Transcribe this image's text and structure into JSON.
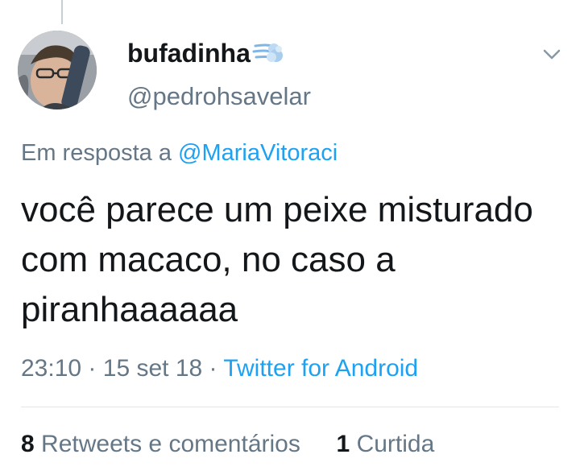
{
  "tweet": {
    "display_name": "bufadinha",
    "name_emoji": "dash-emoji",
    "handle": "@pedrohsavelar",
    "reply_prefix": "Em resposta a",
    "reply_mention": "@MariaVitoraci",
    "text": "você parece um peixe misturado com macaco, no caso a piranhaaaaaa",
    "time": "23:10",
    "date": "15 set 18",
    "separator": "·",
    "source": "Twitter for Android",
    "retweets_count": "8",
    "retweets_label": "Retweets e comentários",
    "likes_count": "1",
    "likes_label": "Curtida"
  },
  "icons": {
    "caret": "chevron-down-icon",
    "avatar": "avatar"
  },
  "colors": {
    "text": "#14171a",
    "secondary": "#657786",
    "link": "#1da1f2",
    "divider": "#e1e8ed"
  }
}
